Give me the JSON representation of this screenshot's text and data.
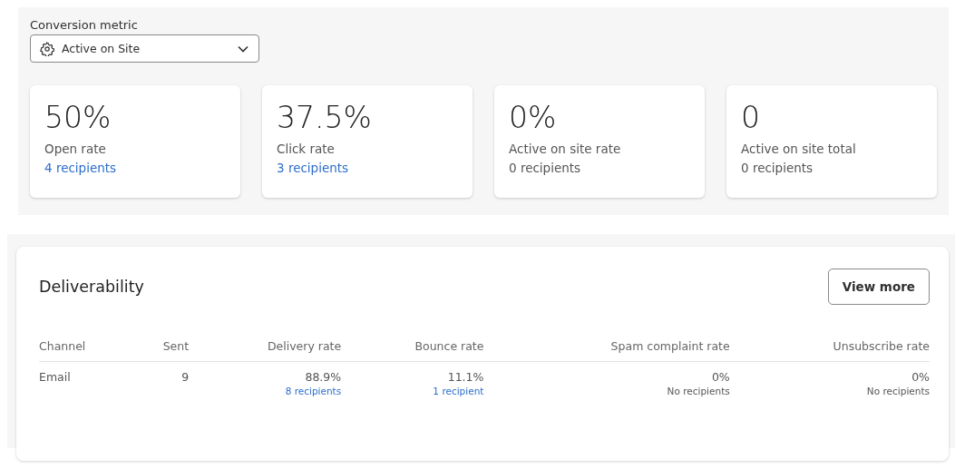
{
  "conversion_metric": {
    "label": "Conversion metric",
    "value": "Active on Site"
  },
  "metric_cards": [
    {
      "value": "50%",
      "label": "Open rate",
      "recipients": "4 recipients",
      "linked": true
    },
    {
      "value": "37.5%",
      "label": "Click rate",
      "recipients": "3 recipients",
      "linked": true
    },
    {
      "value": "0%",
      "label": "Active on site rate",
      "recipients": "0 recipients",
      "linked": false
    },
    {
      "value": "0",
      "label": "Active on site total",
      "recipients": "0 recipients",
      "linked": false
    }
  ],
  "deliverability": {
    "title": "Deliverability",
    "button": "View more",
    "columns": [
      "Channel",
      "Sent",
      "Delivery rate",
      "Bounce rate",
      "Spam complaint rate",
      "Unsubscribe rate"
    ],
    "rows": [
      {
        "channel": "Email",
        "sent": "9",
        "rates": [
          {
            "value": "88.9%",
            "note": "8 recipients",
            "linked": true
          },
          {
            "value": "11.1%",
            "note": "1 recipient",
            "linked": true
          },
          {
            "value": "0%",
            "note": "No recipients",
            "linked": false
          },
          {
            "value": "0%",
            "note": "No recipients",
            "linked": false
          }
        ]
      }
    ]
  }
}
